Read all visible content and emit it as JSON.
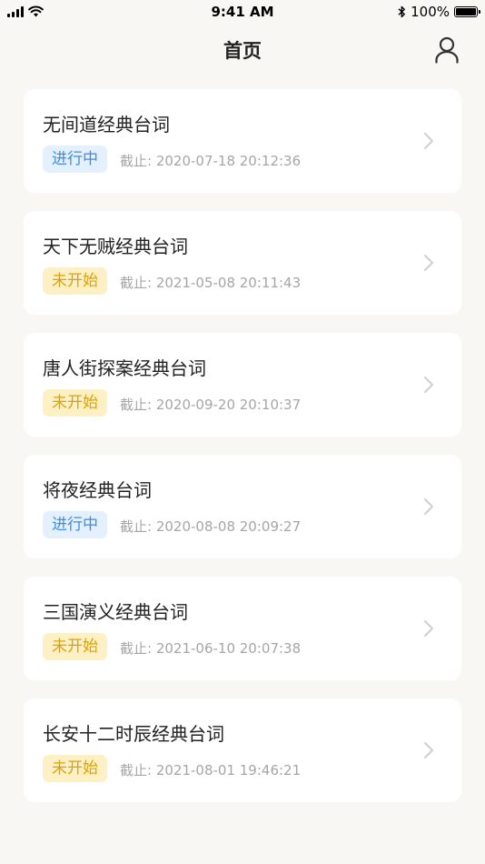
{
  "status_bar": {
    "time": "9:41 AM",
    "battery": "100%",
    "battery_level": 1.0
  },
  "header": {
    "title": "首页",
    "user_icon": "user-icon"
  },
  "items": [
    {
      "title": "无间道经典台词",
      "status": "进行中",
      "status_type": "active",
      "deadline": "截止: 2020-07-18 20:12:36"
    },
    {
      "title": "天下无贼经典台词",
      "status": "未开始",
      "status_type": "pending",
      "deadline": "截止: 2021-05-08 20:11:43"
    },
    {
      "title": "唐人街探案经典台词",
      "status": "未开始",
      "status_type": "pending",
      "deadline": "截止: 2020-09-20 20:10:37"
    },
    {
      "title": "将夜经典台词",
      "status": "进行中",
      "status_type": "active",
      "deadline": "截止: 2020-08-08 20:09:27"
    },
    {
      "title": "三国演义经典台词",
      "status": "未开始",
      "status_type": "pending",
      "deadline": "截止: 2021-06-10 20:07:38"
    },
    {
      "title": "长安十二时辰经典台词",
      "status": "未开始",
      "status_type": "pending",
      "deadline": "截止: 2021-08-01 19:46:21"
    }
  ],
  "colors": {
    "background": "#f8f7f4",
    "active_badge_bg": "#e4f0fd",
    "active_badge_text": "#3a8ee6",
    "pending_badge_bg": "#fdf0c4",
    "pending_badge_text": "#e0a100"
  }
}
